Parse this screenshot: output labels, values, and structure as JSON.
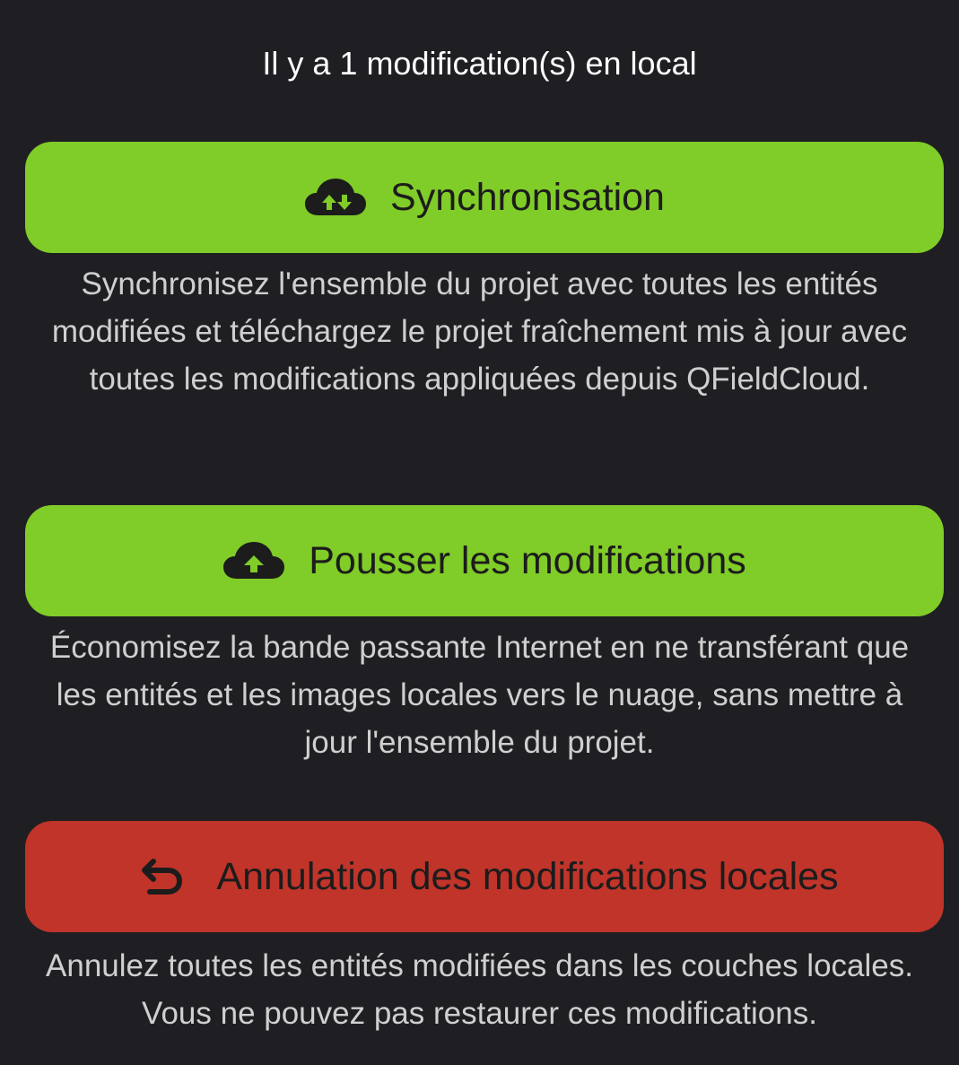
{
  "header": {
    "status_text": "Il y a 1 modification(s) en local"
  },
  "actions": [
    {
      "label": "Synchronisation",
      "icon": "cloud-sync-icon",
      "color": "#80cc28",
      "description": "Synchronisez l'ensemble du projet avec toutes les entités modifiées et téléchargez le projet fraîchement mis à jour avec toutes les modifications appliquées depuis QFieldCloud."
    },
    {
      "label": "Pousser les modifications",
      "icon": "cloud-upload-icon",
      "color": "#80cc28",
      "description": "Économisez la bande passante Internet en ne transférant que les entités et les images locales vers le nuage, sans mettre à jour l'ensemble du projet."
    },
    {
      "label": "Annulation des modifications locales",
      "icon": "undo-arrow-icon",
      "color": "#c0342a",
      "description": "Annulez toutes les entités modifiées dans les couches locales. Vous ne pouvez pas restaurer ces modifications."
    }
  ]
}
